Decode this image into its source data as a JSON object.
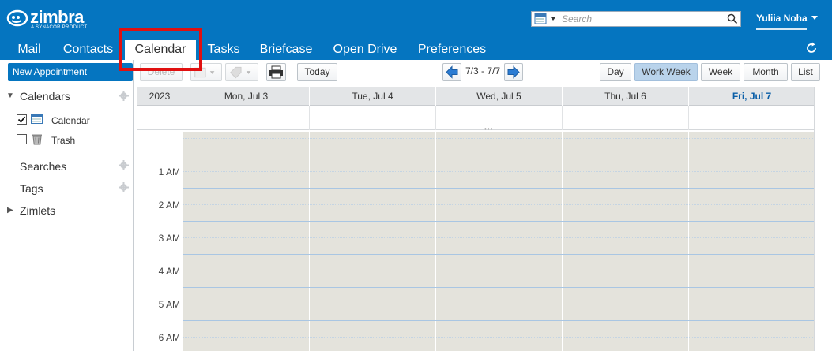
{
  "header": {
    "brand": "zimbra",
    "brand_tagline": "A SYNACOR PRODUCT",
    "search_placeholder": "Search",
    "user_name": "Yuliia Noha"
  },
  "app_tabs": [
    {
      "label": "Mail"
    },
    {
      "label": "Contacts"
    },
    {
      "label": "Calendar",
      "active": true
    },
    {
      "label": "Tasks"
    },
    {
      "label": "Briefcase"
    },
    {
      "label": "Open Drive"
    },
    {
      "label": "Preferences"
    }
  ],
  "sidebar": {
    "new_appointment": "New Appointment",
    "calendars_header": "Calendars",
    "items": [
      {
        "label": "Calendar",
        "checked": true
      },
      {
        "label": "Trash",
        "checked": false
      }
    ],
    "searches": "Searches",
    "tags": "Tags",
    "zimlets": "Zimlets"
  },
  "toolbar": {
    "delete": "Delete",
    "today": "Today",
    "range": "7/3 - 7/7",
    "views": [
      "Day",
      "Work Week",
      "Week",
      "Month",
      "List"
    ],
    "active_view": "Work Week"
  },
  "calendar": {
    "year": "2023",
    "days": [
      "Mon, Jul 3",
      "Tue, Jul 4",
      "Wed, Jul 5",
      "Thu, Jul 6",
      "Fri, Jul 7"
    ],
    "today": "Fri, Jul 7",
    "hours": [
      "1 AM",
      "2 AM",
      "3 AM",
      "4 AM",
      "5 AM",
      "6 AM"
    ]
  },
  "colors": {
    "brand_blue": "#0575c0",
    "grid_background": "#e4e3dc",
    "highlight": "#e01010"
  }
}
